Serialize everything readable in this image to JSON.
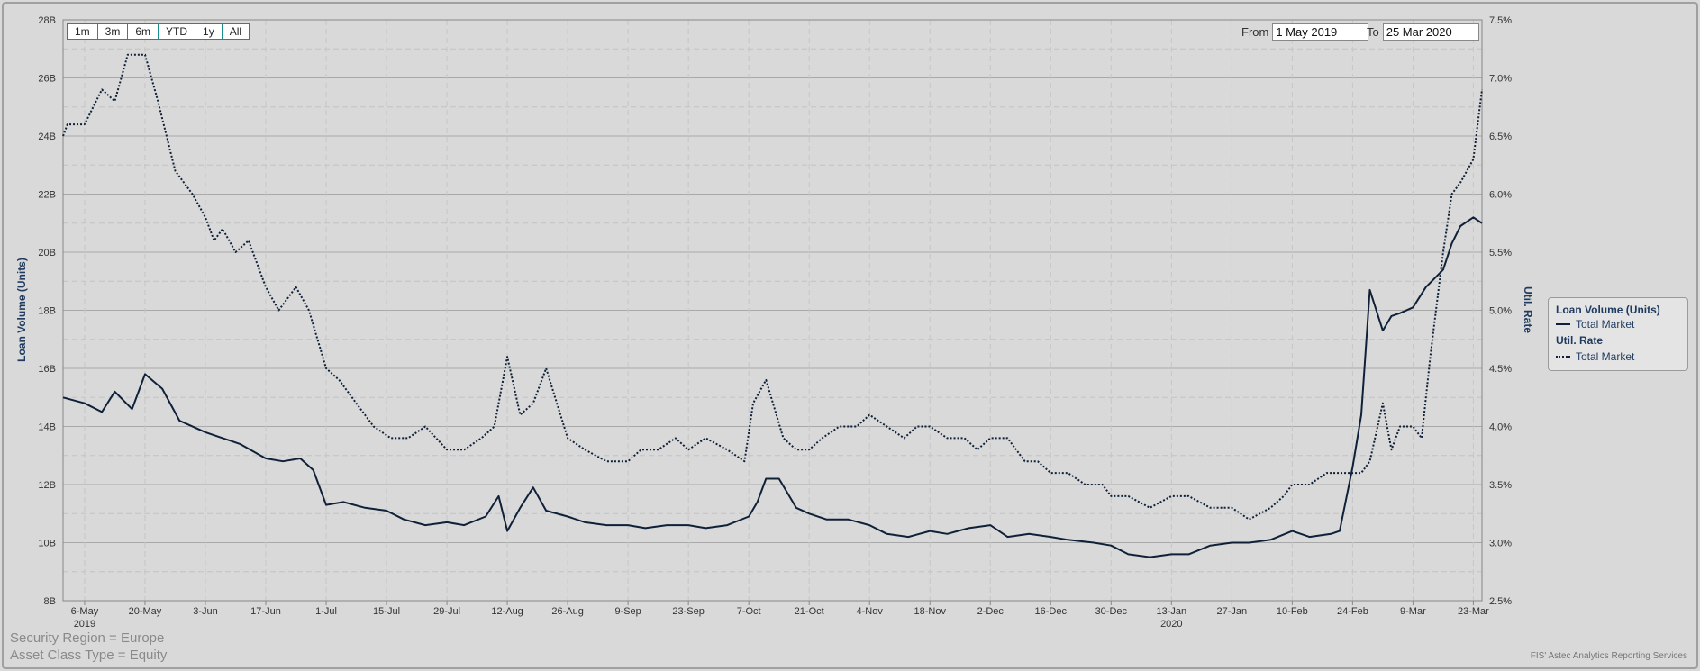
{
  "chart_data": {
    "type": "line",
    "zoom_buttons": [
      "1m",
      "3m",
      "6m",
      "YTD",
      "1y",
      "All"
    ],
    "range": {
      "from_label": "From",
      "from": "1 May 2019",
      "to_label": "To",
      "to": "25 Mar 2020"
    },
    "x_range": [
      "2019-05-01",
      "2020-03-25"
    ],
    "x_ticks": [
      {
        "date": "2019-05-06",
        "label": "6-May"
      },
      {
        "date": "2019-05-20",
        "label": "20-May"
      },
      {
        "date": "2019-06-03",
        "label": "3-Jun"
      },
      {
        "date": "2019-06-17",
        "label": "17-Jun"
      },
      {
        "date": "2019-07-01",
        "label": "1-Jul"
      },
      {
        "date": "2019-07-15",
        "label": "15-Jul"
      },
      {
        "date": "2019-07-29",
        "label": "29-Jul"
      },
      {
        "date": "2019-08-12",
        "label": "12-Aug"
      },
      {
        "date": "2019-08-26",
        "label": "26-Aug"
      },
      {
        "date": "2019-09-09",
        "label": "9-Sep"
      },
      {
        "date": "2019-09-23",
        "label": "23-Sep"
      },
      {
        "date": "2019-10-07",
        "label": "7-Oct"
      },
      {
        "date": "2019-10-21",
        "label": "21-Oct"
      },
      {
        "date": "2019-11-04",
        "label": "4-Nov"
      },
      {
        "date": "2019-11-18",
        "label": "18-Nov"
      },
      {
        "date": "2019-12-02",
        "label": "2-Dec"
      },
      {
        "date": "2019-12-16",
        "label": "16-Dec"
      },
      {
        "date": "2019-12-30",
        "label": "30-Dec"
      },
      {
        "date": "2020-01-13",
        "label": "13-Jan"
      },
      {
        "date": "2020-01-27",
        "label": "27-Jan"
      },
      {
        "date": "2020-02-10",
        "label": "10-Feb"
      },
      {
        "date": "2020-02-24",
        "label": "24-Feb"
      },
      {
        "date": "2020-03-09",
        "label": "9-Mar"
      },
      {
        "date": "2020-03-23",
        "label": "23-Mar"
      }
    ],
    "x_year_labels": [
      {
        "date": "2019-05-06",
        "label": "2019"
      },
      {
        "date": "2020-01-13",
        "label": "2020"
      }
    ],
    "y_left": {
      "label": "Loan Volume (Units)",
      "ylim": [
        8,
        28
      ],
      "ticks": [
        8,
        10,
        12,
        14,
        16,
        18,
        20,
        22,
        24,
        26,
        28
      ],
      "tick_labels": [
        "8B",
        "10B",
        "12B",
        "14B",
        "16B",
        "18B",
        "20B",
        "22B",
        "24B",
        "26B",
        "28B"
      ]
    },
    "y_right": {
      "label": "Util. Rate",
      "ylim": [
        2.5,
        7.5
      ],
      "ticks": [
        2.5,
        3.0,
        3.5,
        4.0,
        4.5,
        5.0,
        5.5,
        6.0,
        6.5,
        7.0,
        7.5
      ],
      "tick_labels": [
        "2.5%",
        "3.0%",
        "3.5%",
        "4.0%",
        "4.5%",
        "5.0%",
        "5.5%",
        "6.0%",
        "6.5%",
        "7.0%",
        "7.5%"
      ]
    },
    "grid": true,
    "legend": {
      "position": "right",
      "groups": [
        {
          "title": "Loan Volume (Units)",
          "entries": [
            {
              "name": "Total Market",
              "style": "solid"
            }
          ]
        },
        {
          "title": "Util. Rate",
          "entries": [
            {
              "name": "Total Market",
              "style": "dotted"
            }
          ]
        }
      ]
    },
    "series": [
      {
        "name": "Total Market",
        "group": "Loan Volume (Units)",
        "axis": "left",
        "style": "solid",
        "color": "#0f2138",
        "x": [
          "2019-05-01",
          "2019-05-06",
          "2019-05-10",
          "2019-05-13",
          "2019-05-17",
          "2019-05-20",
          "2019-05-24",
          "2019-05-28",
          "2019-06-03",
          "2019-06-07",
          "2019-06-11",
          "2019-06-17",
          "2019-06-21",
          "2019-06-25",
          "2019-06-28",
          "2019-07-01",
          "2019-07-05",
          "2019-07-10",
          "2019-07-15",
          "2019-07-19",
          "2019-07-24",
          "2019-07-29",
          "2019-08-02",
          "2019-08-07",
          "2019-08-10",
          "2019-08-12",
          "2019-08-15",
          "2019-08-18",
          "2019-08-21",
          "2019-08-26",
          "2019-08-30",
          "2019-09-04",
          "2019-09-09",
          "2019-09-13",
          "2019-09-18",
          "2019-09-23",
          "2019-09-27",
          "2019-10-02",
          "2019-10-07",
          "2019-10-09",
          "2019-10-11",
          "2019-10-14",
          "2019-10-18",
          "2019-10-21",
          "2019-10-25",
          "2019-10-30",
          "2019-11-04",
          "2019-11-08",
          "2019-11-13",
          "2019-11-18",
          "2019-11-22",
          "2019-11-27",
          "2019-12-02",
          "2019-12-06",
          "2019-12-11",
          "2019-12-16",
          "2019-12-20",
          "2019-12-26",
          "2019-12-30",
          "2020-01-03",
          "2020-01-08",
          "2020-01-13",
          "2020-01-17",
          "2020-01-22",
          "2020-01-27",
          "2020-01-31",
          "2020-02-05",
          "2020-02-10",
          "2020-02-14",
          "2020-02-19",
          "2020-02-21",
          "2020-02-24",
          "2020-02-26",
          "2020-02-28",
          "2020-03-02",
          "2020-03-04",
          "2020-03-06",
          "2020-03-09",
          "2020-03-12",
          "2020-03-16",
          "2020-03-18",
          "2020-03-20",
          "2020-03-23",
          "2020-03-25"
        ],
        "values": [
          15.0,
          14.8,
          14.5,
          15.2,
          14.6,
          15.8,
          15.3,
          14.2,
          13.8,
          13.6,
          13.4,
          12.9,
          12.8,
          12.9,
          12.5,
          11.3,
          11.4,
          11.2,
          11.1,
          10.8,
          10.6,
          10.7,
          10.6,
          10.9,
          11.6,
          10.4,
          11.2,
          11.9,
          11.1,
          10.9,
          10.7,
          10.6,
          10.6,
          10.5,
          10.6,
          10.6,
          10.5,
          10.6,
          10.9,
          11.4,
          12.2,
          12.2,
          11.2,
          11.0,
          10.8,
          10.8,
          10.6,
          10.3,
          10.2,
          10.4,
          10.3,
          10.5,
          10.6,
          10.2,
          10.3,
          10.2,
          10.1,
          10.0,
          9.9,
          9.6,
          9.5,
          9.6,
          9.6,
          9.9,
          10.0,
          10.0,
          10.1,
          10.4,
          10.2,
          10.3,
          10.4,
          12.6,
          14.4,
          18.7,
          17.3,
          17.8,
          17.9,
          18.1,
          18.8,
          19.4,
          20.3,
          20.9,
          21.2,
          21.0
        ]
      },
      {
        "name": "Total Market",
        "group": "Util. Rate",
        "axis": "right",
        "style": "dotted",
        "color": "#0f2138",
        "x": [
          "2019-05-01",
          "2019-05-02",
          "2019-05-06",
          "2019-05-10",
          "2019-05-13",
          "2019-05-16",
          "2019-05-20",
          "2019-05-23",
          "2019-05-27",
          "2019-05-31",
          "2019-06-03",
          "2019-06-05",
          "2019-06-07",
          "2019-06-10",
          "2019-06-13",
          "2019-06-17",
          "2019-06-20",
          "2019-06-24",
          "2019-06-27",
          "2019-07-01",
          "2019-07-04",
          "2019-07-08",
          "2019-07-12",
          "2019-07-16",
          "2019-07-20",
          "2019-07-24",
          "2019-07-29",
          "2019-08-02",
          "2019-08-06",
          "2019-08-09",
          "2019-08-12",
          "2019-08-15",
          "2019-08-18",
          "2019-08-21",
          "2019-08-26",
          "2019-08-30",
          "2019-09-04",
          "2019-09-09",
          "2019-09-12",
          "2019-09-16",
          "2019-09-20",
          "2019-09-23",
          "2019-09-27",
          "2019-10-02",
          "2019-10-06",
          "2019-10-08",
          "2019-10-11",
          "2019-10-15",
          "2019-10-18",
          "2019-10-21",
          "2019-10-24",
          "2019-10-28",
          "2019-11-01",
          "2019-11-04",
          "2019-11-08",
          "2019-11-12",
          "2019-11-15",
          "2019-11-18",
          "2019-11-22",
          "2019-11-26",
          "2019-11-29",
          "2019-12-02",
          "2019-12-06",
          "2019-12-10",
          "2019-12-13",
          "2019-12-16",
          "2019-12-20",
          "2019-12-24",
          "2019-12-28",
          "2019-12-30",
          "2020-01-03",
          "2020-01-08",
          "2020-01-13",
          "2020-01-17",
          "2020-01-22",
          "2020-01-25",
          "2020-01-27",
          "2020-01-31",
          "2020-02-05",
          "2020-02-08",
          "2020-02-10",
          "2020-02-14",
          "2020-02-18",
          "2020-02-21",
          "2020-02-24",
          "2020-02-26",
          "2020-02-28",
          "2020-03-02",
          "2020-03-04",
          "2020-03-06",
          "2020-03-09",
          "2020-03-11",
          "2020-03-13",
          "2020-03-16",
          "2020-03-18",
          "2020-03-20",
          "2020-03-23",
          "2020-03-25"
        ],
        "values": [
          6.5,
          6.6,
          6.6,
          6.9,
          6.8,
          7.2,
          7.2,
          6.8,
          6.2,
          6.0,
          5.8,
          5.6,
          5.7,
          5.5,
          5.6,
          5.2,
          5.0,
          5.2,
          5.0,
          4.5,
          4.4,
          4.2,
          4.0,
          3.9,
          3.9,
          4.0,
          3.8,
          3.8,
          3.9,
          4.0,
          4.6,
          4.1,
          4.2,
          4.5,
          3.9,
          3.8,
          3.7,
          3.7,
          3.8,
          3.8,
          3.9,
          3.8,
          3.9,
          3.8,
          3.7,
          4.2,
          4.4,
          3.9,
          3.8,
          3.8,
          3.9,
          4.0,
          4.0,
          4.1,
          4.0,
          3.9,
          4.0,
          4.0,
          3.9,
          3.9,
          3.8,
          3.9,
          3.9,
          3.7,
          3.7,
          3.6,
          3.6,
          3.5,
          3.5,
          3.4,
          3.4,
          3.3,
          3.4,
          3.4,
          3.3,
          3.3,
          3.3,
          3.2,
          3.3,
          3.4,
          3.5,
          3.5,
          3.6,
          3.6,
          3.6,
          3.6,
          3.7,
          4.2,
          3.8,
          4.0,
          4.0,
          3.9,
          4.6,
          5.5,
          6.0,
          6.1,
          6.3,
          6.9
        ]
      }
    ]
  },
  "footer": {
    "filters": [
      "Security Region = Europe",
      "Asset Class Type = Equity"
    ],
    "credit": "FIS' Astec Analytics Reporting Services"
  }
}
